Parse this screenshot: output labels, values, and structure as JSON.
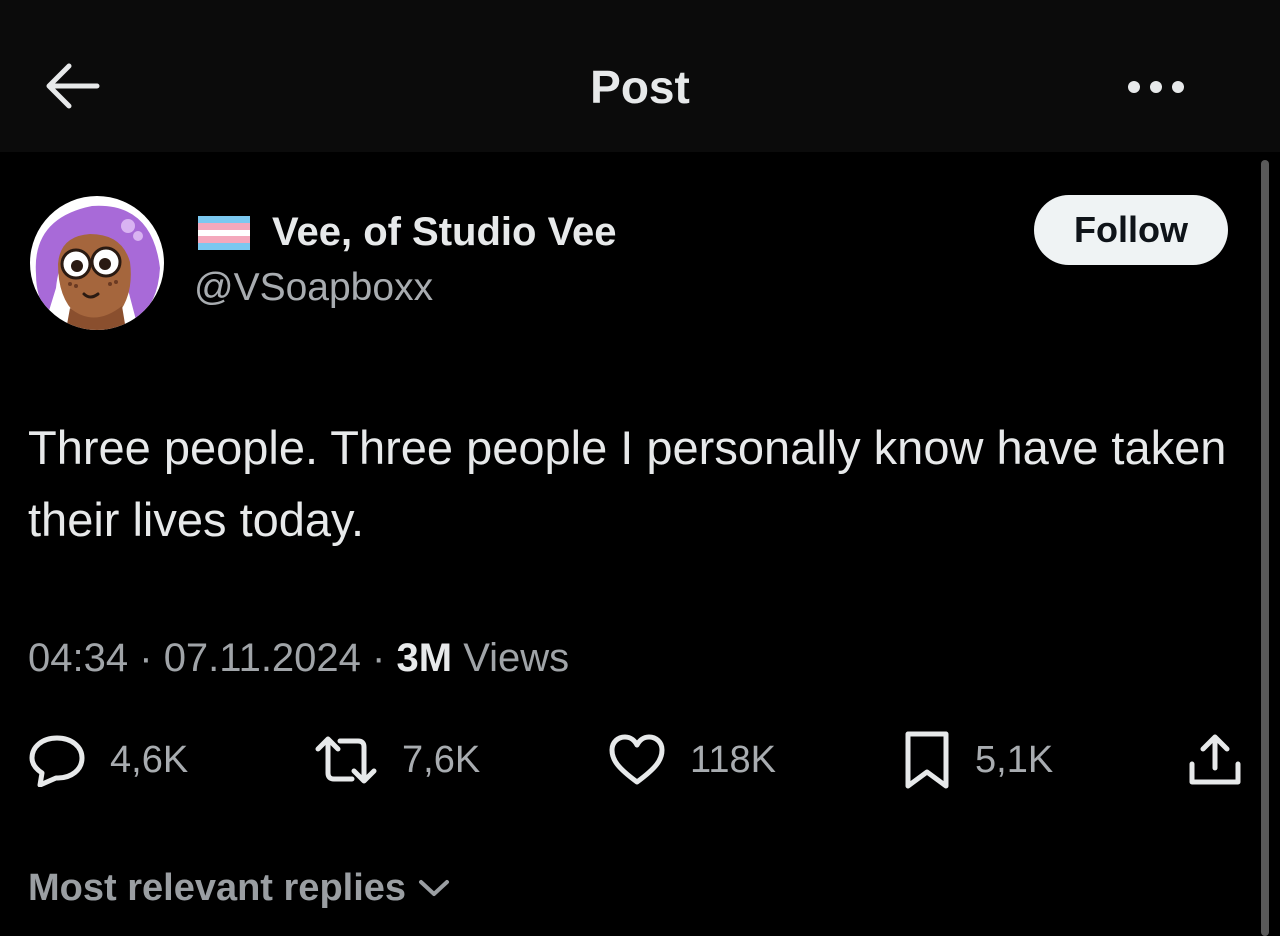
{
  "header": {
    "title": "Post",
    "back_icon": "arrow-left-icon",
    "more_icon": "more-horizontal-icon"
  },
  "author": {
    "display_name": "Vee, of Studio Vee",
    "handle": "@VSoapboxx",
    "flag_icon": "transgender-flag-icon",
    "follow_label": "Follow"
  },
  "post": {
    "text": "Three people. Three people I personally know have taken their lives today.",
    "time": "04:34",
    "date": "07.11.2024",
    "separator": "·",
    "views_count": "3M",
    "views_label": "Views"
  },
  "actions": {
    "replies": "4,6K",
    "reposts": "7,6K",
    "likes": "118K",
    "bookmarks": "5,1K"
  },
  "replies_sort": {
    "label": "Most relevant replies"
  },
  "colors": {
    "background": "#000000",
    "header_background": "#0b0b0b",
    "text_primary": "#e7e9ea",
    "text_secondary": "#a0a4a8",
    "follow_button": "#eff3f4",
    "avatar_hair": "#a86ad8"
  }
}
